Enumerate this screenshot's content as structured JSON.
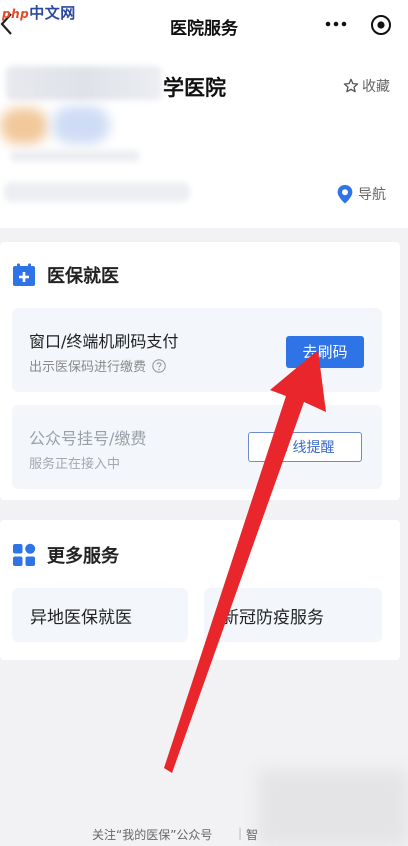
{
  "watermark": {
    "php": "php",
    "text": "中文网"
  },
  "header": {
    "title": "医院服务"
  },
  "hospital": {
    "name": "学医院",
    "favorite_label": "收藏",
    "navigate_label": "导航"
  },
  "medical_insurance": {
    "title": "医保就医",
    "qr_payment": {
      "title": "窗口/终端机刷码支付",
      "subtitle": "出示医保码进行缴费",
      "button": "去刷码"
    },
    "official_account": {
      "title": "公众号挂号/缴费",
      "subtitle": "服务正在接入中",
      "button": "线提醒"
    }
  },
  "more_services": {
    "title": "更多服务",
    "items": [
      {
        "label": "异地医保就医"
      },
      {
        "label": "新冠防疫服务"
      }
    ]
  },
  "footer": {
    "left": "关注“我的医保”公众号",
    "separator": "|",
    "right": "智"
  },
  "colors": {
    "accent": "#2f74e6",
    "arrow": "#e8262b",
    "page_bg": "#f2f2f5"
  }
}
